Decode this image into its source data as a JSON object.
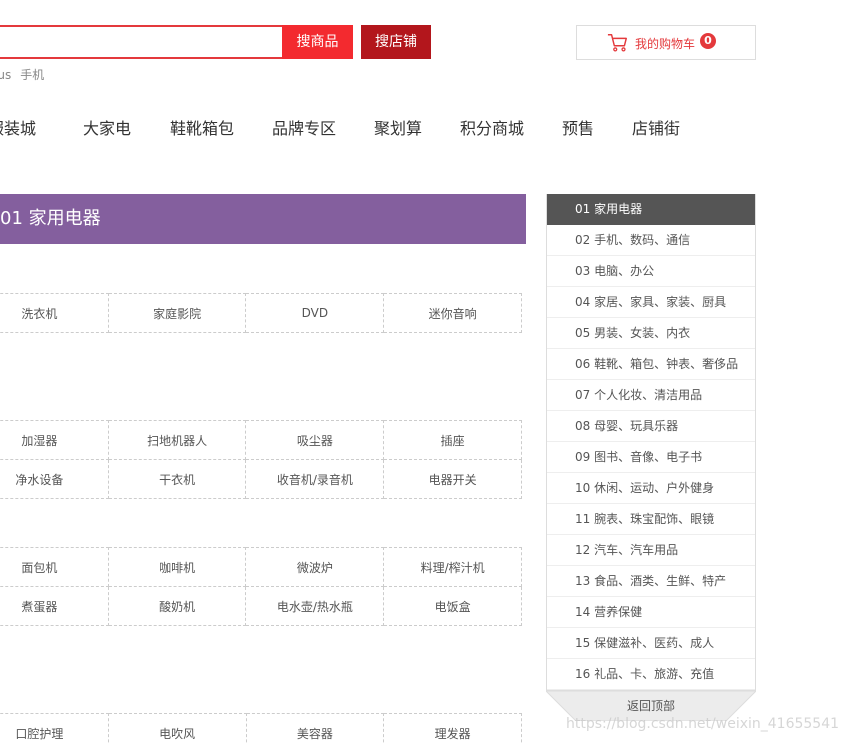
{
  "search": {
    "input_value": "",
    "search_goods_label": "搜商品",
    "search_shop_label": "搜店铺",
    "hotwords": [
      "lus",
      "手机"
    ]
  },
  "cart": {
    "label": "我的购物车",
    "count": "0",
    "icon": "cart-icon",
    "accent_color": "#e4393c"
  },
  "nav": [
    "服装城",
    "大家电",
    "鞋靴箱包",
    "品牌专区",
    "聚划算",
    "积分商城",
    "预售",
    "店铺街"
  ],
  "floor": {
    "title": "01 家用电器",
    "color": "#845f9e"
  },
  "grids": {
    "g1": [
      [
        "洗衣机",
        "家庭影院",
        "DVD",
        "迷你音响"
      ]
    ],
    "g2": [
      [
        "加湿器",
        "扫地机器人",
        "吸尘器",
        "插座"
      ],
      [
        "净水设备",
        "干衣机",
        "收音机/录音机",
        "电器开关"
      ]
    ],
    "g3": [
      [
        "面包机",
        "咖啡机",
        "微波炉",
        "料理/榨汁机"
      ],
      [
        "煮蛋器",
        "酸奶机",
        "电水壶/热水瓶",
        "电饭盒"
      ]
    ],
    "g4": [
      [
        "口腔护理",
        "电吹风",
        "美容器",
        "理发器"
      ]
    ]
  },
  "sidenav": {
    "items": [
      "01 家用电器",
      "02 手机、数码、通信",
      "03 电脑、办公",
      "04 家居、家具、家装、厨具",
      "05 男装、女装、内衣",
      "06 鞋靴、箱包、钟表、奢侈品",
      "07 个人化妆、清洁用品",
      "08 母婴、玩具乐器",
      "09 图书、音像、电子书",
      "10 休闲、运动、户外健身",
      "11 腕表、珠宝配饰、眼镜",
      "12 汽车、汽车用品",
      "13 食品、酒类、生鲜、特产",
      "14 营养保健",
      "15 保健滋补、医药、成人",
      "16 礼品、卡、旅游、充值"
    ],
    "active_index": 0,
    "back_top": "返回顶部"
  },
  "watermark": "https://blog.csdn.net/weixin_41655541"
}
